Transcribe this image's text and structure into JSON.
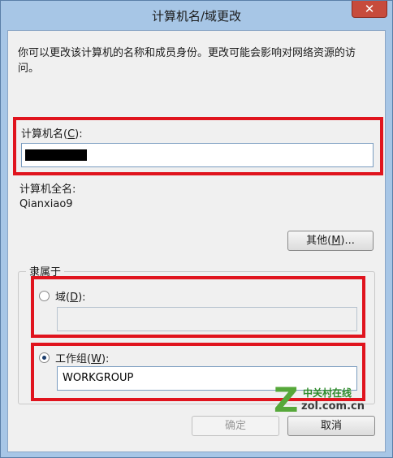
{
  "window": {
    "title": "计算机名/域更改",
    "close_glyph": "✕"
  },
  "description": "你可以更改该计算机的名称和成员身份。更改可能会影响对网络资源的访问。",
  "computer_name": {
    "label_prefix": "计算机名(",
    "label_accel": "C",
    "label_suffix": "):",
    "value": ""
  },
  "full_name": {
    "label": "计算机全名:",
    "value": "Qianxiao9"
  },
  "other_button": {
    "label_prefix": "其他(",
    "label_accel": "M",
    "label_suffix": ")..."
  },
  "member_of": {
    "legend": "隶属于",
    "domain": {
      "label_prefix": "域(",
      "label_accel": "D",
      "label_suffix": "):",
      "value": "",
      "selected": false
    },
    "workgroup": {
      "label_prefix": "工作组(",
      "label_accel": "W",
      "label_suffix": "):",
      "value": "WORKGROUP",
      "selected": true
    }
  },
  "buttons": {
    "ok": "确定",
    "cancel": "取消"
  },
  "watermark": {
    "mark": "Z",
    "brand": "中关村在线",
    "url": "zol.com.cn"
  },
  "colors": {
    "highlight": "#e0141e",
    "titlebar": "#a7c6e6",
    "close": "#c74b3c",
    "watermark_green": "#56a83a"
  }
}
